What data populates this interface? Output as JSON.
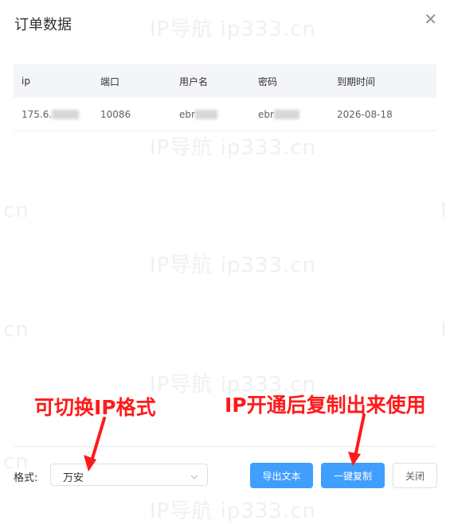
{
  "dialog": {
    "title": "订单数据"
  },
  "watermark": {
    "text": "IP导航 ip333.cn",
    "fragment_left": "cn",
    "fragment_right": "I"
  },
  "table": {
    "columns": [
      "ip",
      "端口",
      "用户名",
      "密码",
      "到期时间"
    ],
    "rows": [
      {
        "ip": "175.6.",
        "port": "10086",
        "username": "ebr",
        "password": "ebr",
        "expiry": "2026-08-18"
      }
    ]
  },
  "footer": {
    "format_label": "格式:",
    "format_value": "万安",
    "export_text_button": "导出文本",
    "copy_button": "一键复制",
    "close_button": "关闭"
  },
  "annotations": {
    "switch_format": "可切换IP格式",
    "copy_hint": "IP开通后复制出来使用"
  },
  "colors": {
    "primary": "#409eff",
    "annotation": "#ff1a1a"
  }
}
